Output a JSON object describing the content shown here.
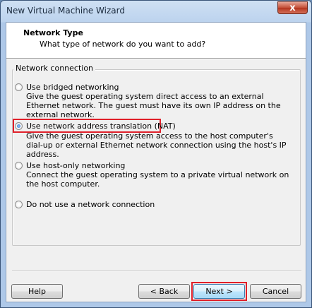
{
  "window": {
    "title": "New Virtual Machine Wizard",
    "close_symbol": "x"
  },
  "header": {
    "title": "Network Type",
    "subtitle": "What type of network do you want to add?"
  },
  "group": {
    "label": "Network connection"
  },
  "options": [
    {
      "label": "Use bridged networking",
      "checked": false,
      "description": "Give the guest operating system direct access to an external Ethernet network. The guest must have its own IP address on the external network."
    },
    {
      "label": "Use network address translation (NAT)",
      "checked": true,
      "description": "Give the guest operating system access to the host computer's dial-up or external Ethernet network connection using the host's IP address."
    },
    {
      "label": "Use host-only networking",
      "checked": false,
      "description": "Connect the guest operating system to a private virtual network on the host computer."
    },
    {
      "label": "Do not use a network connection",
      "checked": false,
      "description": ""
    }
  ],
  "buttons": {
    "help": "Help",
    "back": "< Back",
    "next": "Next >",
    "cancel": "Cancel"
  },
  "colors": {
    "highlight": "#e0202a",
    "accent": "#3c7fb1"
  }
}
